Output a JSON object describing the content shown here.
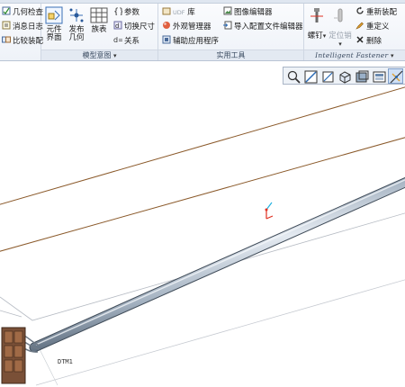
{
  "ribbon": {
    "check_group": {
      "items": [
        "几何检查",
        "消息日志",
        "比较装配"
      ]
    },
    "model_intent_group": {
      "big_buttons": [
        {
          "line1": "元件",
          "line2": "界面"
        },
        {
          "line1": "发布",
          "line2": "几何"
        },
        {
          "line1": "族表",
          "line2": ""
        }
      ],
      "small_items": [
        "参数",
        "切换尺寸",
        "关系"
      ],
      "label": "模型意图"
    },
    "utilities_group": {
      "left_items": [
        {
          "prefix": "UDF",
          "text": "库"
        },
        {
          "prefix": "",
          "text": "外观管理器"
        },
        {
          "prefix": "",
          "text": "辅助应用程序"
        }
      ],
      "right_items": [
        "图像编辑器",
        "导入配置文件编辑器"
      ],
      "label": "实用工具"
    },
    "fastener_group": {
      "bolt_label": "螺钉",
      "pin_label": "定位销",
      "right_items": [
        "重新装配",
        "重定义",
        "删除"
      ],
      "label": "Intelligent Fastener"
    }
  },
  "viewport": {
    "dimension_label": "DTM1"
  },
  "colors": {
    "datum_plane": "#8b5a2b",
    "rod_light": "#e4eaf1",
    "rod_mid": "#a3b1c0",
    "rod_dark": "#5e6d7e",
    "connector": "#7a5037",
    "cs_x": "#e03020",
    "cs_y": "#20b0e0"
  }
}
